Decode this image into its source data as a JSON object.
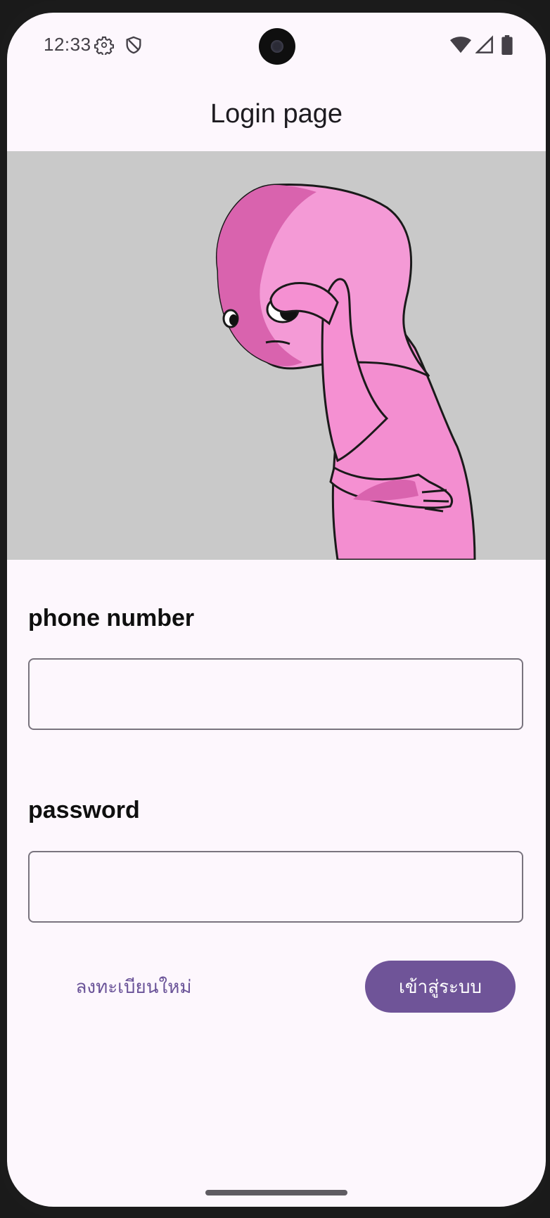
{
  "status_bar": {
    "time": "12:33",
    "left_icons": [
      "gear-icon",
      "shield-icon"
    ],
    "right_icons": [
      "wifi-icon",
      "signal-icon",
      "battery-icon"
    ]
  },
  "app_bar": {
    "title": "Login page"
  },
  "hero": {
    "description_icon": "pink-cartoon-illustration"
  },
  "form": {
    "phone_label": "phone number",
    "phone_value": "",
    "password_label": "password",
    "password_value": ""
  },
  "actions": {
    "register_label": "ลงทะเบียนใหม่",
    "login_label": "เข้าสู่ระบบ"
  },
  "colors": {
    "background": "#fdf7fd",
    "primary": "#6f5498",
    "hero_background": "#c9c9c9",
    "field_border": "#79747e"
  }
}
